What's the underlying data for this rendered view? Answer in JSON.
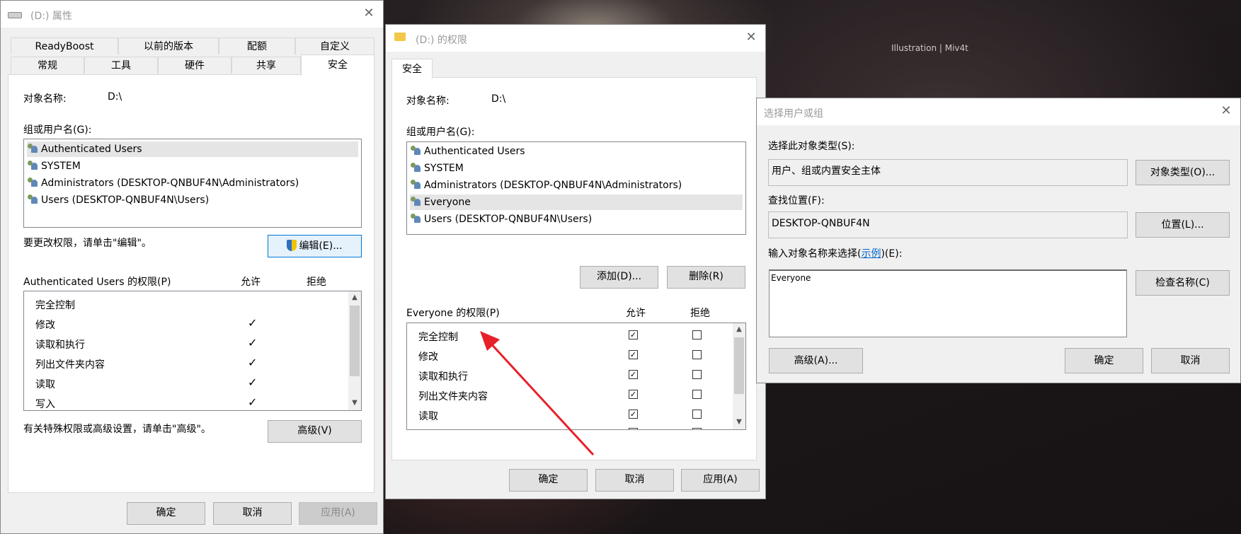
{
  "background": {
    "watermark": "Illustration | Miv4t"
  },
  "win1": {
    "title": "(D:) 属性",
    "tabs_row1": [
      "ReadyBoost",
      "以前的版本",
      "配额",
      "自定义"
    ],
    "tabs_row2": [
      "常规",
      "工具",
      "硬件",
      "共享",
      "安全"
    ],
    "object_label": "对象名称:",
    "object_value": "D:\\",
    "group_label": "组或用户名(G):",
    "users": [
      "Authenticated Users",
      "SYSTEM",
      "Administrators (DESKTOP-QNBUF4N\\Administrators)",
      "Users (DESKTOP-QNBUF4N\\Users)"
    ],
    "edit_hint": "要更改权限，请单击\"编辑\"。",
    "edit_button": "编辑(E)...",
    "perm_header": "Authenticated Users 的权限(P)",
    "allow": "允许",
    "deny": "拒绝",
    "perms": [
      "完全控制",
      "修改",
      "读取和执行",
      "列出文件夹内容",
      "读取",
      "写入"
    ],
    "perm_allow_checked": [
      false,
      true,
      true,
      true,
      true,
      true
    ],
    "adv_hint": "有关特殊权限或高级设置，请单击\"高级\"。",
    "adv_button": "高级(V)",
    "ok": "确定",
    "cancel": "取消",
    "apply": "应用(A)"
  },
  "win2": {
    "title": "(D:) 的权限",
    "tab": "安全",
    "object_label": "对象名称:",
    "object_value": "D:\\",
    "group_label": "组或用户名(G):",
    "users": [
      "Authenticated Users",
      "SYSTEM",
      "Administrators (DESKTOP-QNBUF4N\\Administrators)",
      "Everyone",
      "Users (DESKTOP-QNBUF4N\\Users)"
    ],
    "selected_user": "Everyone",
    "add_button": "添加(D)...",
    "remove_button": "删除(R)",
    "perm_header": "Everyone 的权限(P)",
    "allow": "允许",
    "deny": "拒绝",
    "perms": [
      "完全控制",
      "修改",
      "读取和执行",
      "列出文件夹内容",
      "读取"
    ],
    "perm_allow_checked": [
      true,
      true,
      true,
      true,
      true
    ],
    "perm_deny_checked": [
      false,
      false,
      false,
      false,
      false
    ],
    "ok": "确定",
    "cancel": "取消",
    "apply": "应用(A)"
  },
  "win3": {
    "title": "选择用户或组",
    "type_label": "选择此对象类型(S):",
    "type_value": "用户、组或内置安全主体",
    "type_button": "对象类型(O)...",
    "loc_label": "查找位置(F):",
    "loc_value": "DESKTOP-QNBUF4N",
    "loc_button": "位置(L)...",
    "name_label_pre": "输入对象名称来选择(",
    "name_label_link": "示例",
    "name_label_post": ")(E):",
    "name_value": "Everyone",
    "check_button": "检查名称(C)",
    "adv_button": "高级(A)...",
    "ok": "确定",
    "cancel": "取消"
  },
  "colors": {
    "arrow": "#e8202a",
    "accent": "#0078d7"
  }
}
